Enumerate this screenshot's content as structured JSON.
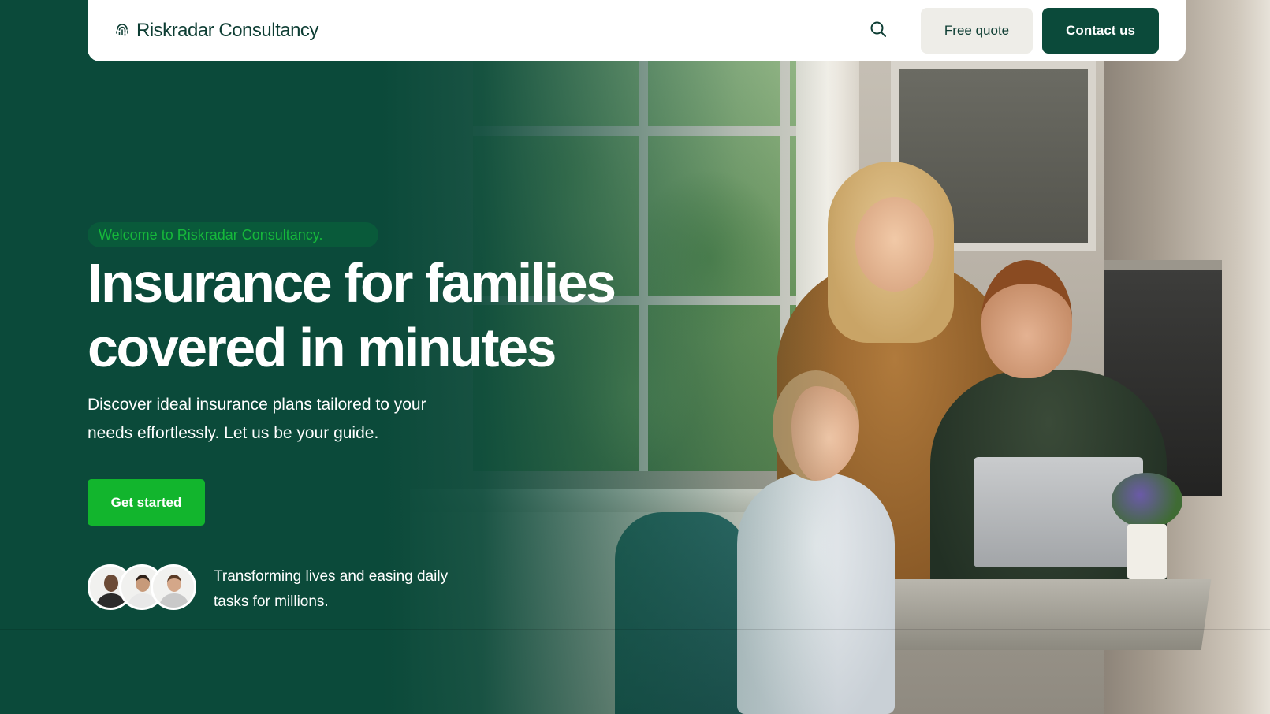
{
  "brand": {
    "name": "Riskradar Consultancy",
    "icon": "fingerprint-icon"
  },
  "nav": {
    "search_icon": "search-icon",
    "free_quote_label": "Free quote",
    "contact_label": "Contact us"
  },
  "hero": {
    "welcome": "Welcome to Riskradar Consultancy.",
    "headline_line1": "Insurance for families",
    "headline_line2": "covered in minutes",
    "subtext": "Discover ideal insurance plans tailored to your needs effortlessly. Let us be your guide.",
    "cta_label": "Get started",
    "social_proof": "Transforming lives and easing daily tasks for millions."
  },
  "colors": {
    "primary_dark_green": "#0b4a3a",
    "accent_green": "#12b52d",
    "welcome_text_green": "#16b83b",
    "nav_bg": "#ffffff",
    "free_quote_bg": "#eeede8"
  }
}
